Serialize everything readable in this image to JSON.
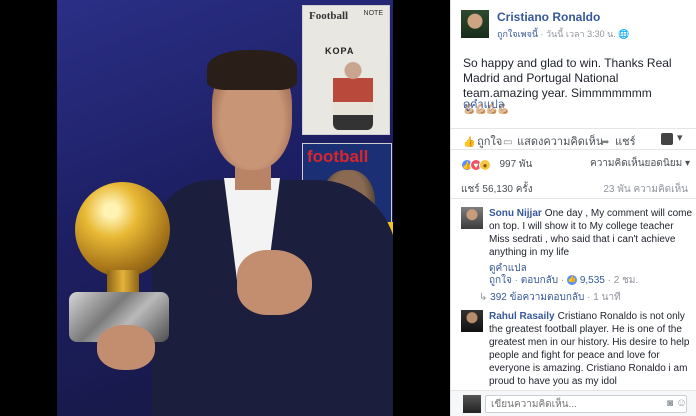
{
  "photo": {
    "magazine_1": {
      "title": "Football",
      "issue": "NOTE",
      "name": "KOPA"
    },
    "magazine_2": {
      "title": "football"
    }
  },
  "post": {
    "page_name": "Cristiano Ronaldo",
    "like_page": "ถูกใจเพจนี้",
    "meta_sep": " · ",
    "timestamp": "วันนี้ เวลา 3:30 น.",
    "globe_icon": "globe-icon",
    "text": "So happy and glad to win. Thanks Real Madrid and Portugal National team.amazing year. Simmmmmmm",
    "emojis": "💪🏼💪🏼💪🏼💪🏼",
    "translate": "ดูคำแปล"
  },
  "actions": {
    "like": "ถูกใจ",
    "comment": "แสดงความคิดเห็น",
    "share": "แชร์",
    "caret": "▾"
  },
  "stats": {
    "reaction_count": "997 พัน",
    "top_comments": "ความคิดเห็นยอดนิยม",
    "caret": "▾",
    "shares": "แชร์ 56,130 ครั้ง",
    "comment_total": "23 พัน ความคิดเห็น"
  },
  "comments": [
    {
      "name": "Sonu Nijjar",
      "text": "One day , My comment will come on top. I will show it to My college teacher Miss sedrati , who said that i can't achieve anything in my life",
      "translate": "ดูคำแปล",
      "like": "ถูกใจ",
      "reply": "ตอบกลับ",
      "sep": " · ",
      "likes": "9,535",
      "time": "2 ชม.",
      "replies": "392 ข้อความตอบกลับ",
      "replies_time": "1 นาที"
    },
    {
      "name": "Rahul Rasaily",
      "text": "Cristiano Ronaldo is not only the greatest football player. He is one of the greatest men in our history. His desire to help people and fight for peace and love for everyone is amazing. Cristiano Ronaldo i am proud to have you as my idol"
    }
  ],
  "composer": {
    "placeholder": "เขียนความคิดเห็น...",
    "camera_icon": "◙",
    "emoji_icon": "☺"
  }
}
